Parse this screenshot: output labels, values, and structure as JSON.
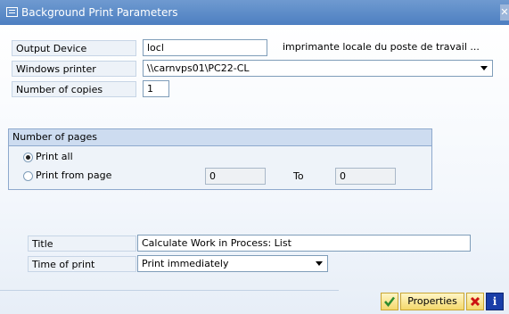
{
  "window": {
    "title": "Background Print Parameters",
    "close": "✕"
  },
  "form": {
    "output_device": {
      "label": "Output Device",
      "value": "locl",
      "description": "imprimante locale du poste de travail ..."
    },
    "windows_printer": {
      "label": "Windows printer",
      "value": "\\\\carnvps01\\PC22-CL"
    },
    "copies": {
      "label": "Number of copies",
      "value": "1"
    }
  },
  "pages": {
    "title": "Number of pages",
    "print_all": "Print all",
    "print_from": "Print from page",
    "from_value": "0",
    "to_label": "To",
    "to_value": "0",
    "selected": "print_all"
  },
  "job": {
    "title_label": "Title",
    "title_value": "Calculate Work in Process: List",
    "time_label": "Time of print",
    "time_value": "Print immediately"
  },
  "buttons": {
    "properties": "Properties"
  },
  "colors": {
    "titlebar": "#5b88c6",
    "accept": "#2e8b2e",
    "cancel": "#cc1111",
    "info": "#1a3ea8"
  }
}
